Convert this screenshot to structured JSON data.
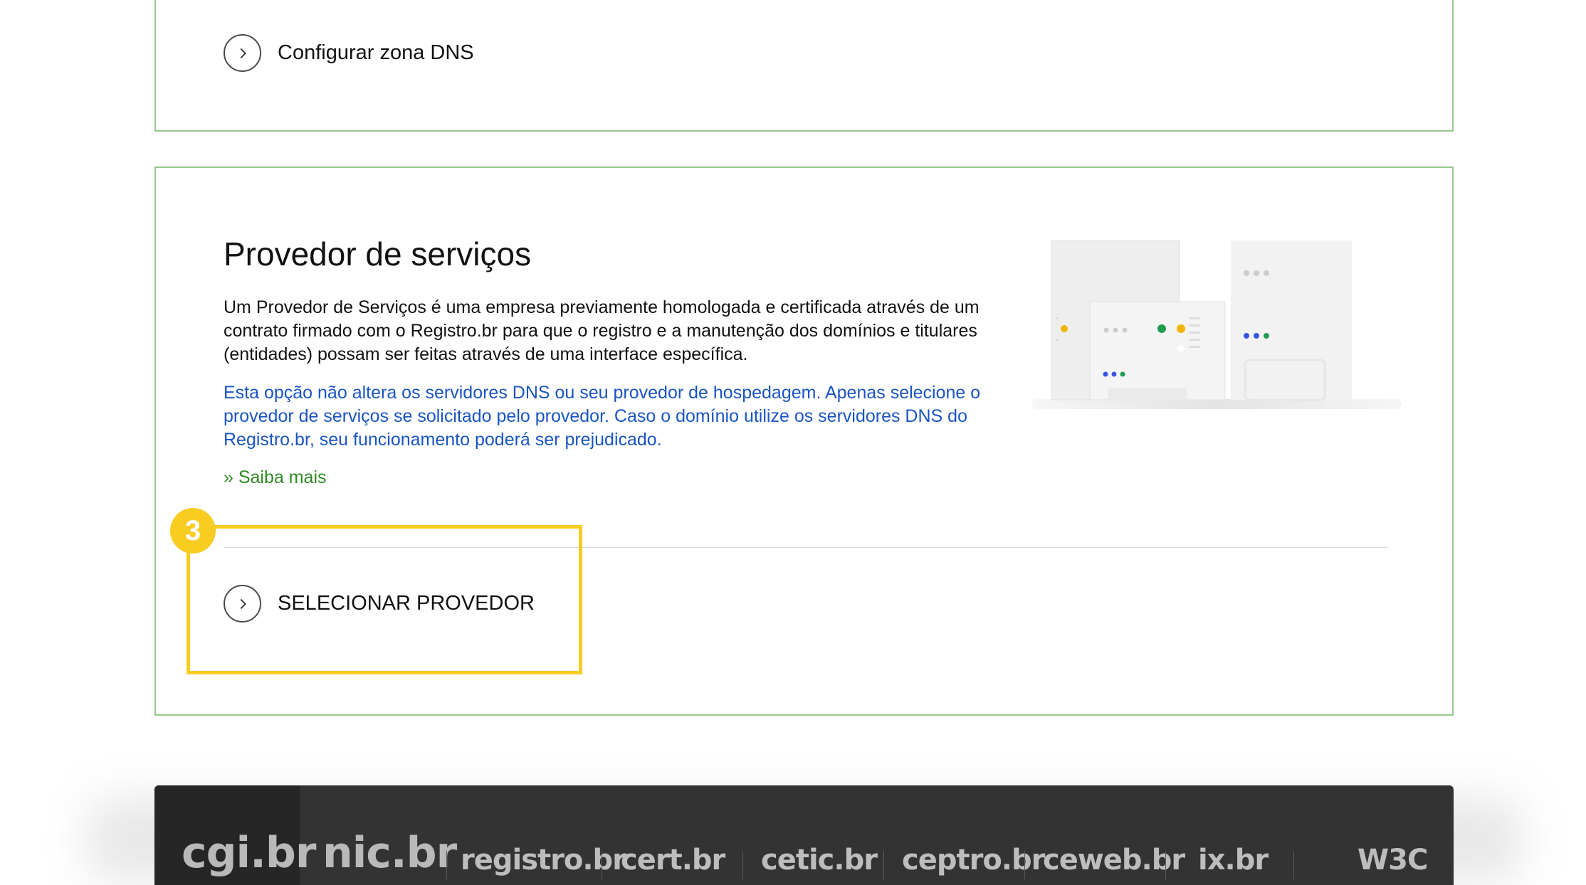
{
  "top_card": {
    "action_label": "Configurar zona DNS"
  },
  "provider": {
    "title": "Provedor de serviços",
    "description": "Um Provedor de Serviços é uma empresa previamente homologada e certificada através de um contrato firmado com o Registro.br para que o registro e a manutenção dos domínios e titulares (entidades) possam ser feitas através de uma interface específica.",
    "warning": "Esta opção não altera os servidores DNS ou seu provedor de hospedagem. Apenas selecione o provedor de serviços se solicitado pelo provedor. Caso o domínio utilize os servidores DNS do Registro.br, seu funcionamento poderá ser prejudicado.",
    "learn_more": "» Saiba mais",
    "select_label": "SELECIONAR PROVEDOR"
  },
  "annotation": {
    "step_number": "3",
    "color": "#f8cc20"
  },
  "footer": {
    "logos": [
      "cgi.br",
      "nic.br",
      "registro.br",
      "cert.br",
      "cetic.br",
      "ceptro.br",
      "ceweb.br",
      "ix.br",
      "W3C"
    ]
  },
  "colors": {
    "card_border": "#98c98e",
    "link_blue": "#1a55c4",
    "link_green": "#2f8a25",
    "footer_bg": "#333333"
  },
  "icons": {
    "action_chevron": "chevron-right-icon"
  }
}
